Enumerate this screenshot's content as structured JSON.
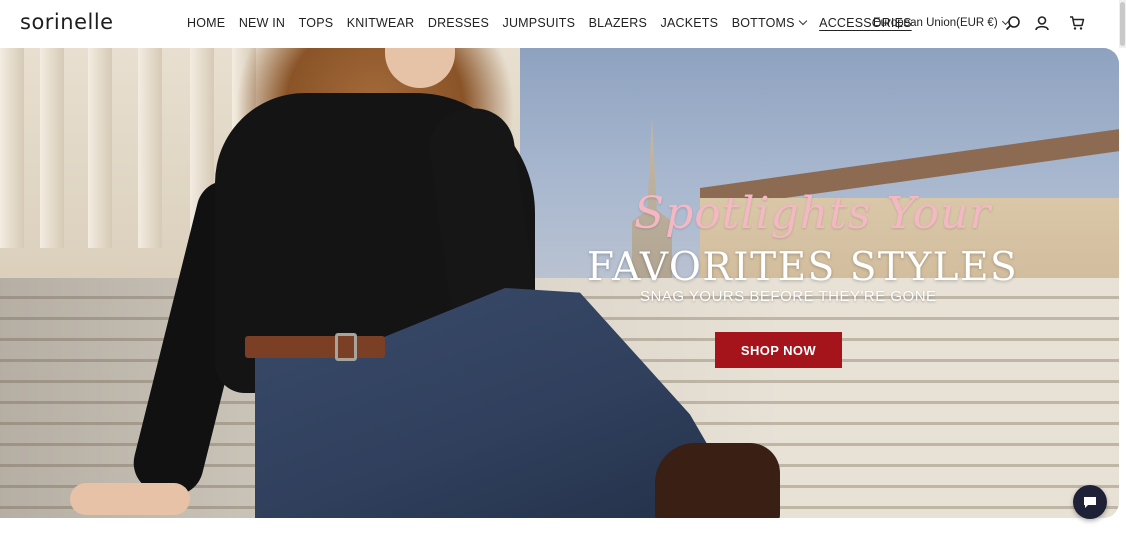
{
  "brand": {
    "logo": "sorinelle"
  },
  "nav": {
    "items": [
      {
        "label": "HOME"
      },
      {
        "label": "NEW IN"
      },
      {
        "label": "TOPS"
      },
      {
        "label": "KNITWEAR"
      },
      {
        "label": "DRESSES"
      },
      {
        "label": "JUMPSUITS"
      },
      {
        "label": "BLAZERS"
      },
      {
        "label": "JACKETS"
      },
      {
        "label": "BOTTOMS"
      },
      {
        "label": "ACCESSORIES"
      }
    ]
  },
  "header": {
    "region": "European Union(EUR €)",
    "icons": [
      "search-icon",
      "account-icon",
      "cart-icon"
    ]
  },
  "hero": {
    "script_text": "Spotlights Your",
    "headline": "FAVORITES STYLES",
    "subline": "SNAG YOURS BEFORE THEY'RE GONE",
    "cta": "SHOP NOW"
  },
  "colors": {
    "cta": "#a4141a",
    "script": "#f3b8c4",
    "chat": "#1f2236"
  },
  "chat": {
    "icon": "chat-bubble-icon"
  }
}
